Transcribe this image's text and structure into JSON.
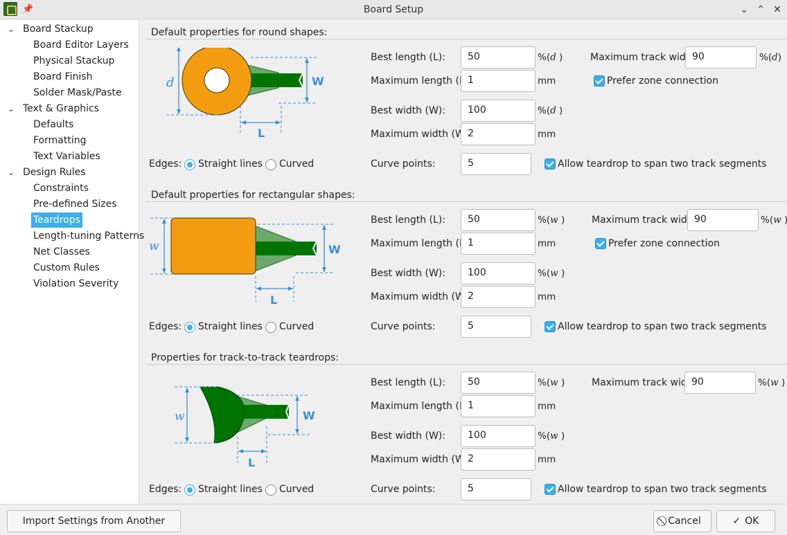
{
  "window": {
    "title": "Board Setup",
    "pin_icon": "pin-icon",
    "controls": [
      "minimize-icon",
      "maximize-icon",
      "close-icon"
    ]
  },
  "sidebar": {
    "items": [
      {
        "label": "Board Stackup",
        "level": 0,
        "expanded": true
      },
      {
        "label": "Board Editor Layers",
        "level": 1
      },
      {
        "label": "Physical Stackup",
        "level": 1
      },
      {
        "label": "Board Finish",
        "level": 1
      },
      {
        "label": "Solder Mask/Paste",
        "level": 1
      },
      {
        "label": "Text & Graphics",
        "level": 0,
        "expanded": true
      },
      {
        "label": "Defaults",
        "level": 1
      },
      {
        "label": "Formatting",
        "level": 1
      },
      {
        "label": "Text Variables",
        "level": 1
      },
      {
        "label": "Design Rules",
        "level": 0,
        "expanded": true
      },
      {
        "label": "Constraints",
        "level": 1
      },
      {
        "label": "Pre-defined Sizes",
        "level": 1
      },
      {
        "label": "Teardrops",
        "level": 1,
        "selected": true
      },
      {
        "label": "Length-tuning Patterns",
        "level": 1
      },
      {
        "label": "Net Classes",
        "level": 1
      },
      {
        "label": "Custom Rules",
        "level": 1
      },
      {
        "label": "Violation Severity",
        "level": 1
      }
    ]
  },
  "colors": {
    "accent": "#3daee9",
    "pad_orange": "#f39c12",
    "track_green": "#007400",
    "teardrop_green": "#6aaa6a",
    "dimension_blue": "#3c8fd0"
  },
  "sections": [
    {
      "title": "Default properties for round shapes:",
      "diagram": {
        "dim_d": "d",
        "dim_w": "W",
        "dim_l": "L"
      },
      "best_length_label": "Best length (L):",
      "best_length": "50",
      "best_length_unit_prefix": "%(",
      "best_length_unit_var": "d",
      "best_length_unit_suffix": " )",
      "max_length_label": "Maximum length (L):",
      "max_length": "1",
      "max_length_unit": "mm",
      "best_width_label": "Best width (W):",
      "best_width": "100",
      "best_width_unit_prefix": "%(",
      "best_width_unit_var": "d",
      "best_width_unit_suffix": " )",
      "max_width_label": "Maximum width (W):",
      "max_width": "2",
      "max_width_unit": "mm",
      "curve_points_label": "Curve points:",
      "curve_points": "5",
      "max_track_width_label": "Maximum track width:",
      "max_track_width": "90",
      "max_track_width_unit_prefix": "%(",
      "max_track_width_unit_var": "d",
      "max_track_width_unit_suffix": ")",
      "prefer_zone_label": "Prefer zone connection",
      "prefer_zone": true,
      "allow_span_label": "Allow teardrop to span two track segments",
      "allow_span": true,
      "edges_label": "Edges:",
      "edges_straight": "Straight lines",
      "edges_curved": "Curved",
      "edges_value": "straight"
    },
    {
      "title": "Default properties for rectangular shapes:",
      "diagram": {
        "dim_d": "w",
        "dim_w": "W",
        "dim_l": "L"
      },
      "best_length_label": "Best length (L):",
      "best_length": "50",
      "best_length_unit_prefix": "%(",
      "best_length_unit_var": "w",
      "best_length_unit_suffix": " )",
      "max_length_label": "Maximum length (L):",
      "max_length": "1",
      "max_length_unit": "mm",
      "best_width_label": "Best width (W):",
      "best_width": "100",
      "best_width_unit_prefix": "%(",
      "best_width_unit_var": "w",
      "best_width_unit_suffix": " )",
      "max_width_label": "Maximum width (W):",
      "max_width": "2",
      "max_width_unit": "mm",
      "curve_points_label": "Curve points:",
      "curve_points": "5",
      "max_track_width_label": "Maximum track width:",
      "max_track_width": "90",
      "max_track_width_unit_prefix": "%(",
      "max_track_width_unit_var": "w",
      "max_track_width_unit_suffix": " )",
      "prefer_zone_label": "Prefer zone connection",
      "prefer_zone": true,
      "allow_span_label": "Allow teardrop to span two track segments",
      "allow_span": true,
      "edges_label": "Edges:",
      "edges_straight": "Straight lines",
      "edges_curved": "Curved",
      "edges_value": "straight"
    },
    {
      "title": "Properties for track-to-track teardrops:",
      "diagram": {
        "dim_d": "w",
        "dim_w": "W",
        "dim_l": "L"
      },
      "best_length_label": "Best length (L):",
      "best_length": "50",
      "best_length_unit_prefix": "%(",
      "best_length_unit_var": "w",
      "best_length_unit_suffix": " )",
      "max_length_label": "Maximum length (L):",
      "max_length": "1",
      "max_length_unit": "mm",
      "best_width_label": "Best width (W):",
      "best_width": "100",
      "best_width_unit_prefix": "%(",
      "best_width_unit_var": "w",
      "best_width_unit_suffix": " )",
      "max_width_label": "Maximum width (W):",
      "max_width": "2",
      "max_width_unit": "mm",
      "curve_points_label": "Curve points:",
      "curve_points": "5",
      "max_track_width_label": "Maximum track width",
      "max_track_width": "90",
      "max_track_width_unit_prefix": "%(",
      "max_track_width_unit_var": "w",
      "max_track_width_unit_suffix": " )",
      "allow_span_label": "Allow teardrop to span two track segments",
      "allow_span": true,
      "edges_label": "Edges:",
      "edges_straight": "Straight lines",
      "edges_curved": "Curved",
      "edges_value": "straight"
    }
  ],
  "footer": {
    "import_label": "Import Settings from Another Board...",
    "cancel_label": "Cancel",
    "ok_label": "OK"
  }
}
